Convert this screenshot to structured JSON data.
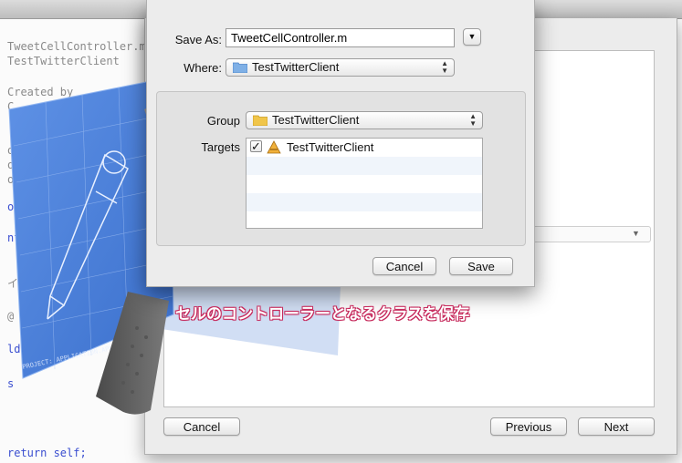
{
  "background_code": {
    "lines": [
      "TweetCellController.m",
      "TestTwitterClient",
      "Created by",
      "C",
      "oo",
      "oo",
      "oo",
      "o",
      "nt",
      "イ",
      "@",
      "ld",
      "s",
      "return self;"
    ]
  },
  "colors": {
    "caption_outline": "#c62a5c",
    "code_keyword": "#3a4ed0",
    "dialog_bg": "#ececec"
  },
  "save_dialog": {
    "save_as_label": "Save As:",
    "save_as_value": "TweetCellController.m",
    "where_label": "Where:",
    "where_value": "TestTwitterClient",
    "group_label": "Group",
    "group_value": "TestTwitterClient",
    "targets_label": "Targets",
    "targets": [
      {
        "name": "TestTwitterClient",
        "checked": true
      }
    ],
    "cancel_label": "Cancel",
    "save_label": "Save",
    "expand_icon": "chevron-down-icon",
    "folder_icon": "folder-icon",
    "target_icon": "xcode-app-icon"
  },
  "wizard": {
    "cancel_label": "Cancel",
    "previous_label": "Previous",
    "next_label": "Next"
  },
  "caption": "セルのコントローラーとなるクラスを保存"
}
